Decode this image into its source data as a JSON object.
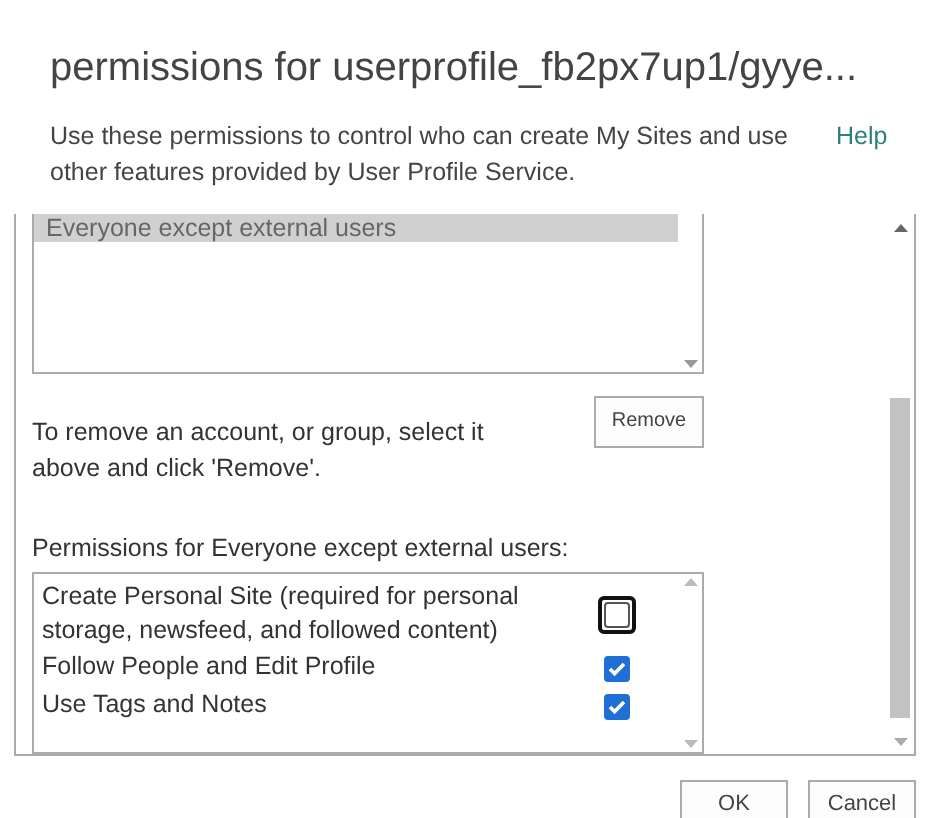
{
  "title": "permissions for userprofile_fb2px7up1/gyye...",
  "description": "Use these permissions to control who can create My Sites and use other features provided by User Profile Service.",
  "help_link": "Help",
  "accounts": [
    {
      "name": "Everyone except external users",
      "selected": true
    }
  ],
  "remove_hint": "To remove an account, or group, select it above and click 'Remove'.",
  "remove_button": "Remove",
  "permissions_label": "Permissions for Everyone except external users:",
  "permissions": [
    {
      "label": "Create Personal Site (required for personal storage, newsfeed, and followed content)",
      "checked": false,
      "focused": true
    },
    {
      "label": "Follow People and Edit Profile",
      "checked": true,
      "focused": false
    },
    {
      "label": "Use Tags and Notes",
      "checked": true,
      "focused": false
    }
  ],
  "buttons": [
    "OK",
    "Cancel"
  ]
}
